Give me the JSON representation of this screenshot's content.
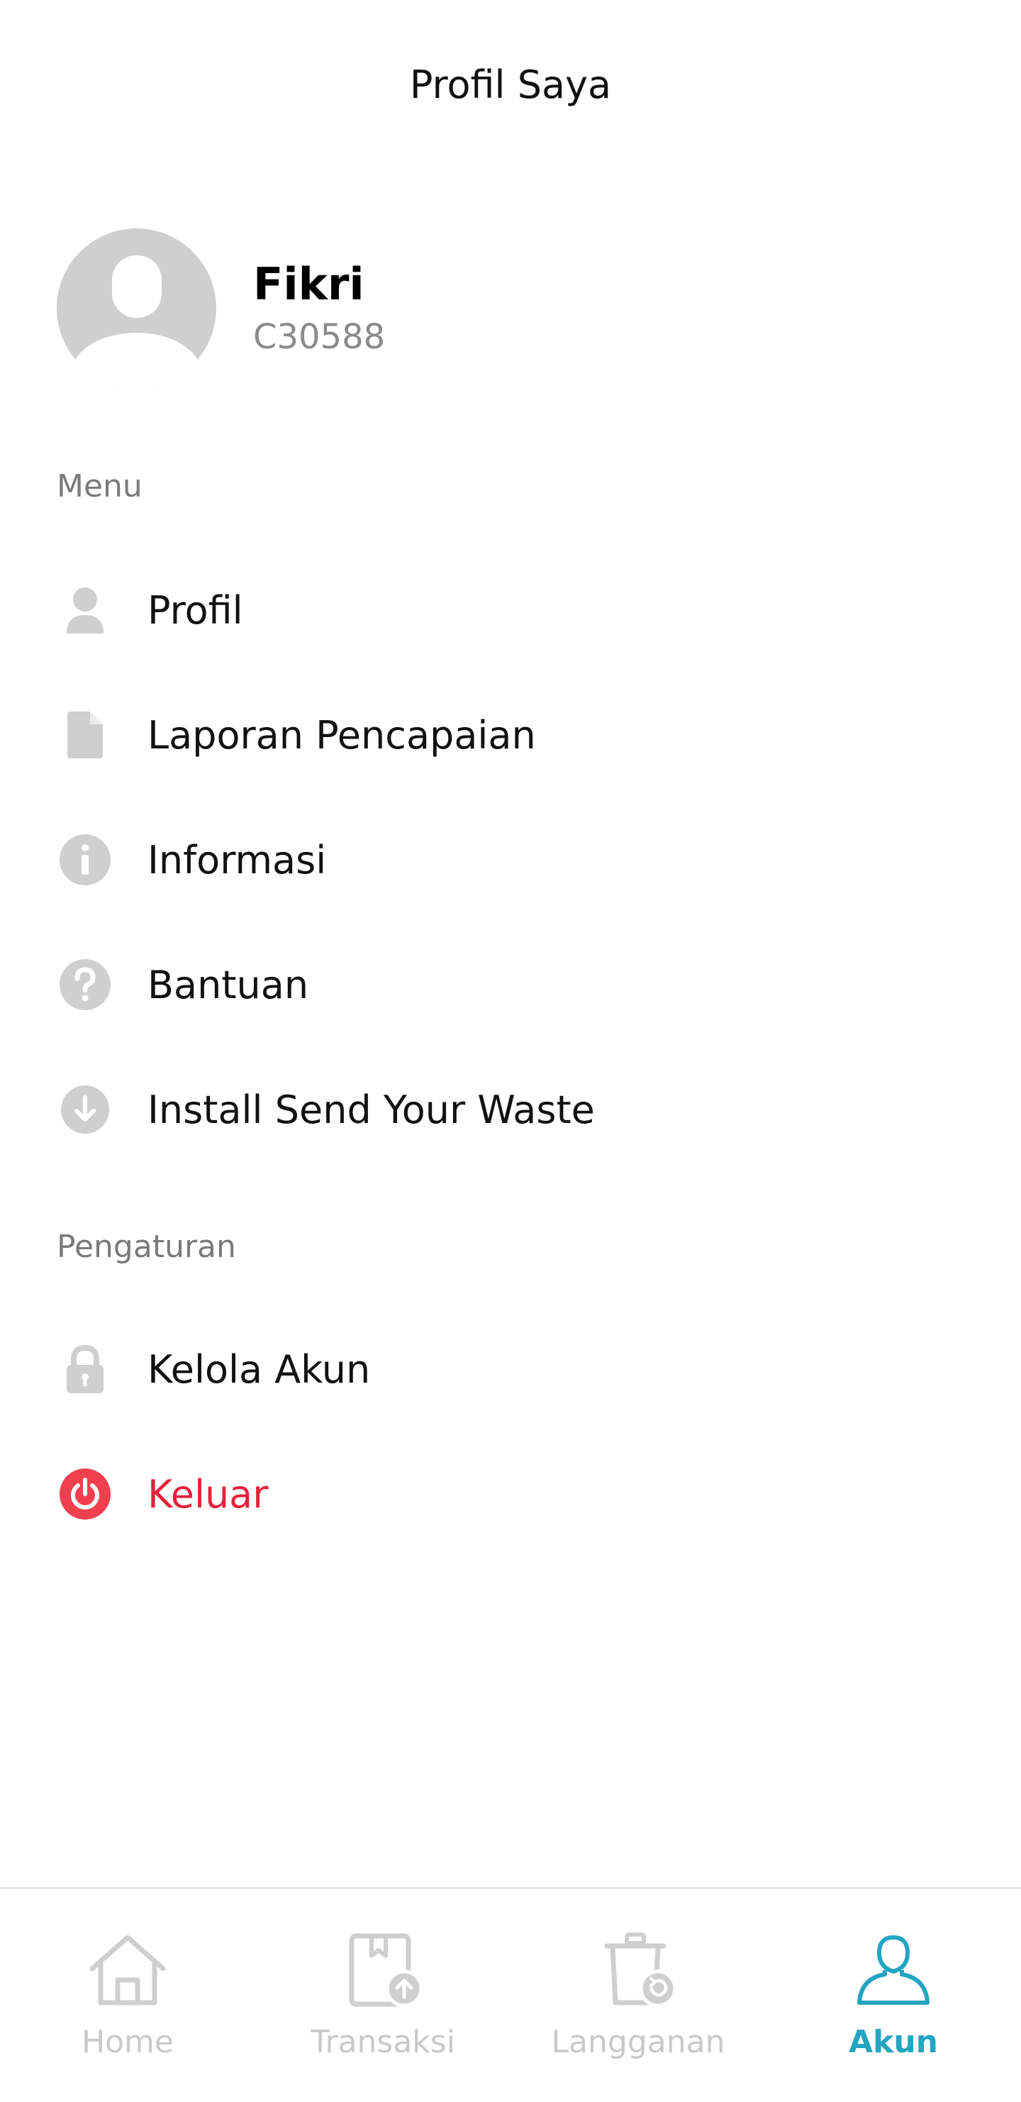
{
  "header": {
    "title": "Profil Saya"
  },
  "user": {
    "name": "Fikri",
    "id": "C30588"
  },
  "menu_section": {
    "label": "Menu",
    "items": [
      {
        "label": "Profil",
        "icon": "person-icon"
      },
      {
        "label": "Laporan Pencapaian",
        "icon": "document-icon"
      },
      {
        "label": "Informasi",
        "icon": "info-icon"
      },
      {
        "label": "Bantuan",
        "icon": "help-icon"
      },
      {
        "label": "Install Send Your Waste",
        "icon": "download-icon"
      }
    ]
  },
  "settings_section": {
    "label": "Pengaturan",
    "items": [
      {
        "label": "Kelola Akun",
        "icon": "lock-icon"
      },
      {
        "label": "Keluar",
        "icon": "power-icon"
      }
    ]
  },
  "bottom_nav": {
    "items": [
      {
        "label": "Home",
        "icon": "home-icon"
      },
      {
        "label": "Transaksi",
        "icon": "transaction-icon"
      },
      {
        "label": "Langganan",
        "icon": "subscription-icon"
      },
      {
        "label": "Akun",
        "icon": "account-icon",
        "active": true
      }
    ]
  },
  "colors": {
    "accent": "#23a5c1",
    "danger": "#e5213c",
    "icon_gray": "#cfcfcf",
    "muted_text": "#7a7a7a"
  }
}
